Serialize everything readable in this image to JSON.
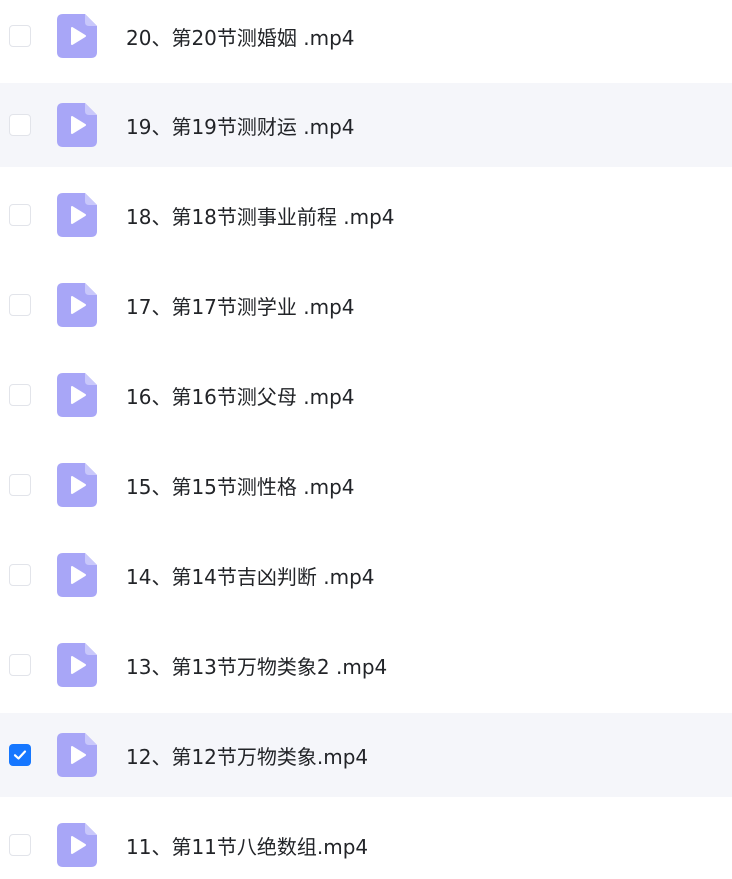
{
  "files": [
    {
      "name": "20、第20节测婚姻 .mp4",
      "checked": false
    },
    {
      "name": "19、第19节测财运 .mp4",
      "checked": false
    },
    {
      "name": "18、第18节测事业前程 .mp4",
      "checked": false
    },
    {
      "name": "17、第17节测学业 .mp4",
      "checked": false
    },
    {
      "name": "16、第16节测父母 .mp4",
      "checked": false
    },
    {
      "name": "15、第15节测性格 .mp4",
      "checked": false
    },
    {
      "name": "14、第14节吉凶判断 .mp4",
      "checked": false
    },
    {
      "name": "13、第13节万物类象2 .mp4",
      "checked": false
    },
    {
      "name": "12、第12节万物类象.mp4",
      "checked": true
    },
    {
      "name": "11、第11节八绝数组.mp4",
      "checked": false
    }
  ],
  "colors": {
    "accent": "#1677ff",
    "icon": "#a8a6f7",
    "row_highlight": "#f5f6fa"
  },
  "icons": {
    "file": "video-file-icon",
    "check": "checkmark-icon"
  }
}
